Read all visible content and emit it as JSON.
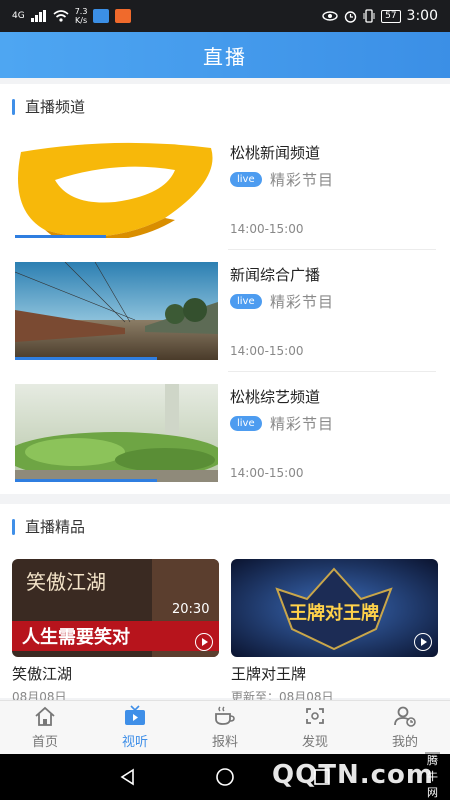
{
  "status_bar": {
    "signal": "4G",
    "speed_value": "7.3",
    "speed_unit": "K/s",
    "battery": "57",
    "time": "3:00"
  },
  "header": {
    "title": "直播"
  },
  "live_channels": {
    "section_title": "直播频道",
    "items": [
      {
        "name": "松桃新闻频道",
        "badge": "live",
        "tag": "精彩节目",
        "time": "14:00-15:00",
        "progress": 0.45
      },
      {
        "name": "新闻综合广播",
        "badge": "live",
        "tag": "精彩节目",
        "time": "14:00-15:00",
        "progress": 0.7
      },
      {
        "name": "松桃综艺频道",
        "badge": "live",
        "tag": "精彩节目",
        "time": "14:00-15:00",
        "progress": 0.7
      }
    ]
  },
  "live_premium": {
    "section_title": "直播精品",
    "cards": [
      {
        "title": "笑傲江湖",
        "date": "08月08日",
        "image_text_top": "笑傲江湖",
        "image_text_bottom": "人生需要笑对",
        "image_text_time": "20:30"
      },
      {
        "title": "王牌对王牌",
        "date": "更新至：08月08日",
        "image_text": "王牌对王牌"
      }
    ]
  },
  "tabs": [
    {
      "label": "首页",
      "icon": "home-icon",
      "active": false
    },
    {
      "label": "视听",
      "icon": "tv-icon",
      "active": true
    },
    {
      "label": "报料",
      "icon": "cup-icon",
      "active": false
    },
    {
      "label": "发现",
      "icon": "discover-icon",
      "active": false
    },
    {
      "label": "我的",
      "icon": "profile-icon",
      "active": false
    }
  ],
  "watermark": {
    "site": "腾牛网",
    "brand": "QQTN.com"
  },
  "colors": {
    "accent": "#3f8fe8",
    "header_gradient_start": "#4ea6f2",
    "live_badge": "#4d9cf0"
  }
}
